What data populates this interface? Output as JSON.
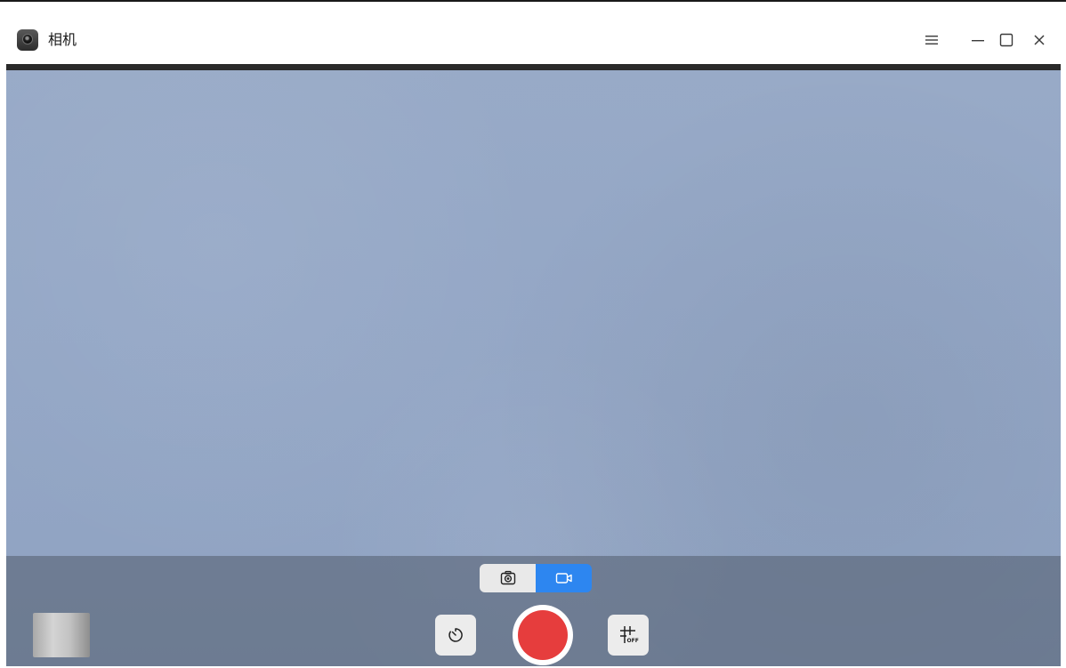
{
  "window": {
    "title": "相机",
    "controls": [
      "menu-icon",
      "minimize-icon",
      "maximize-icon",
      "close-icon"
    ]
  },
  "camera": {
    "modes": [
      {
        "icon": "camera-icon",
        "active": false
      },
      {
        "icon": "video-icon",
        "active": true
      }
    ],
    "grid_label": "OFF",
    "shutter_color": "#e63d3d",
    "accent": "#2d86f0"
  }
}
